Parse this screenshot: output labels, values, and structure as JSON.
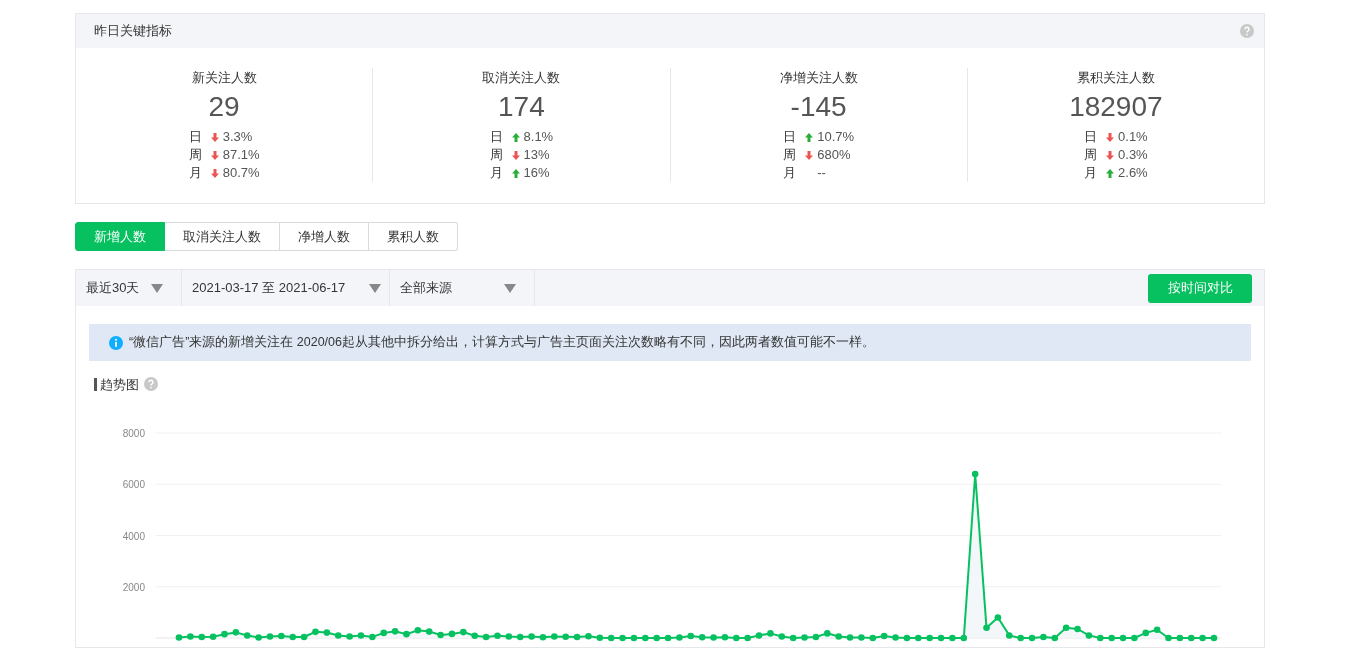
{
  "panel": {
    "title": "昨日关键指标"
  },
  "metrics": [
    {
      "label": "新关注人数",
      "value": "29",
      "changes": [
        {
          "period": "日",
          "up": false,
          "text": "3.3%"
        },
        {
          "period": "周",
          "up": false,
          "text": "87.1%"
        },
        {
          "period": "月",
          "up": false,
          "text": "80.7%"
        }
      ]
    },
    {
      "label": "取消关注人数",
      "value": "174",
      "changes": [
        {
          "period": "日",
          "up": true,
          "text": "8.1%"
        },
        {
          "period": "周",
          "up": false,
          "text": "13%"
        },
        {
          "period": "月",
          "up": true,
          "text": "16%"
        }
      ]
    },
    {
      "label": "净增关注人数",
      "value": "-145",
      "changes": [
        {
          "period": "日",
          "up": true,
          "text": "10.7%"
        },
        {
          "period": "周",
          "up": false,
          "text": "680%"
        },
        {
          "period": "月",
          "text": "--"
        }
      ]
    },
    {
      "label": "累积关注人数",
      "value": "182907",
      "changes": [
        {
          "period": "日",
          "up": false,
          "text": "0.1%"
        },
        {
          "period": "周",
          "up": false,
          "text": "0.3%"
        },
        {
          "period": "月",
          "up": true,
          "text": "2.6%"
        }
      ]
    }
  ],
  "tabs": [
    {
      "label": "新增人数",
      "selected": true
    },
    {
      "label": "取消关注人数",
      "selected": false
    },
    {
      "label": "净增人数",
      "selected": false
    },
    {
      "label": "累积人数",
      "selected": false
    }
  ],
  "filters": [
    {
      "text": "最近30天"
    },
    {
      "text": "2021-03-17 至 2021-06-17"
    },
    {
      "text": "全部来源"
    }
  ],
  "compare_button": "按时间对比",
  "notice": "“微信广告”来源的新增关注在 2020/06起从其他中拆分给出，计算方式与广告主页面关注次数略有不同，因此两者数值可能不一样。",
  "trend": {
    "title": "趋势图",
    "chart_data": {
      "type": "area",
      "grid": true,
      "marker": true,
      "ylim": [
        0,
        8000
      ],
      "yticks": [
        2000,
        4000,
        6000,
        8000
      ],
      "values": [
        20,
        60,
        40,
        50,
        150,
        220,
        100,
        20,
        60,
        80,
        40,
        40,
        240,
        210,
        100,
        60,
        100,
        40,
        200,
        260,
        150,
        300,
        250,
        120,
        160,
        230,
        90,
        40,
        90,
        60,
        40,
        60,
        30,
        60,
        50,
        40,
        70,
        10,
        0,
        0,
        0,
        0,
        0,
        0,
        20,
        80,
        30,
        20,
        30,
        0,
        0,
        100,
        180,
        60,
        0,
        20,
        40,
        180,
        60,
        20,
        20,
        0,
        80,
        20,
        0,
        0,
        0,
        0,
        0,
        0,
        6400,
        400,
        800,
        100,
        0,
        0,
        40,
        0,
        400,
        350,
        100,
        0,
        0,
        0,
        0,
        200,
        320,
        0,
        0,
        0,
        0,
        0
      ]
    }
  }
}
